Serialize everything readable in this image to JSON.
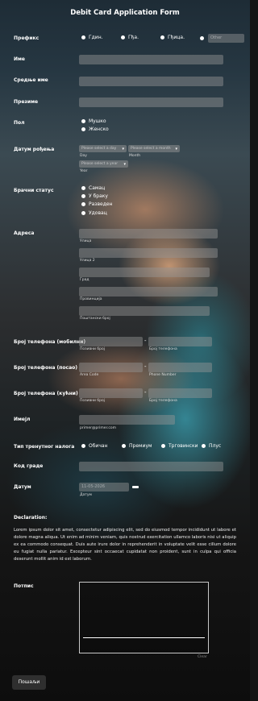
{
  "form": {
    "title": "Debit Card Application Form"
  },
  "prefix": {
    "label": "Префикс",
    "options": [
      "Гдин.",
      "Гђа.",
      "Гђица."
    ],
    "other_placeholder": "Other"
  },
  "fields": {
    "first_name": "Име",
    "middle_name": "Средње име",
    "last_name": "Презиме"
  },
  "gender": {
    "label": "Пол",
    "options": [
      "Мушко",
      "Женско"
    ]
  },
  "birthdate": {
    "label": "Датум рођења",
    "day_placeholder": "Please select a day",
    "month_placeholder": "Please select a month",
    "year_placeholder": "Please select a year",
    "day_sub": "Day",
    "month_sub": "Month",
    "year_sub": "Year"
  },
  "marital": {
    "label": "Брачни статус",
    "options": [
      "Самац",
      "У браку",
      "Разведен",
      "Удовац"
    ]
  },
  "address": {
    "label": "Адреса",
    "subs": [
      "Улица",
      "Улица 2",
      "Град",
      "Провинција",
      "Поштански број"
    ]
  },
  "phone_mobile": {
    "label": "Број телефона (мобилни)",
    "sub_area": "Позивни број",
    "sub_number": "Број телефона"
  },
  "phone_work": {
    "label": "Број телефона (посао)",
    "sub_area": "Area Code",
    "sub_number": "Phone Number"
  },
  "phone_home": {
    "label": "Број телефона (кућни)",
    "sub_area": "Позивни број",
    "sub_number": "Број телефона"
  },
  "email": {
    "label": "Имејл",
    "sub": "primer@primer.com"
  },
  "account_type": {
    "label": "Тип тренутног налога",
    "options": [
      "Обичан",
      "Премиум",
      "Трговински",
      "Плус"
    ]
  },
  "city_code": {
    "label": "Код граде"
  },
  "date": {
    "label": "Датум",
    "value": "11-05-2026",
    "sub": "Датум"
  },
  "declaration": {
    "title": "Declaration:",
    "text": "Lorem ipsum dolor sit amet, consectetur adipiscing elit, sed do eiusmod tempor incididunt ut labore et dolore magna aliqua. Ut enim ad minim veniam, quis nostrud exercitation ullamco laboris nisi ut aliquip ex ea commodo consequat. Duis aute irure dolor in reprehenderit in voluptate velit esse cillum dolore eu fugiat nulla pariatur. Excepteur sint occaecat cupidatat non proident, sunt in culpa qui officia deserunt mollit anim id est laborum."
  },
  "signature": {
    "label": "Потпис",
    "clear": "Clear"
  },
  "submit": {
    "label": "Пошаљи"
  }
}
